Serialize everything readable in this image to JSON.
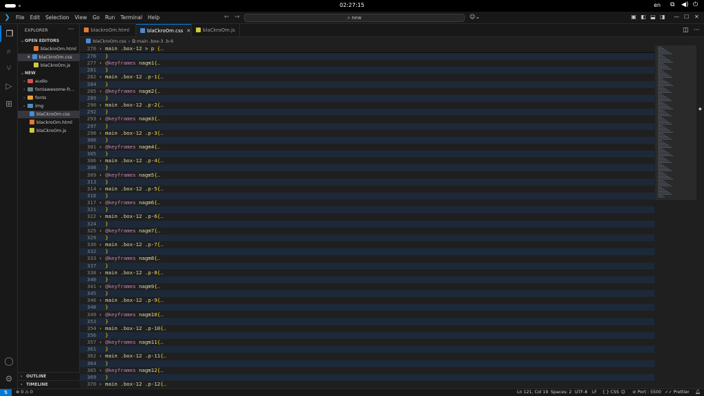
{
  "system": {
    "clock": "02:27:15",
    "language": "en"
  },
  "titlebar": {
    "menu": [
      "File",
      "Edit",
      "Selection",
      "View",
      "Go",
      "Run",
      "Terminal",
      "Help"
    ],
    "search_text": "new"
  },
  "sidebar": {
    "title": "EXPLORER",
    "open_editors_label": "OPEN EDITORS",
    "open_editors": [
      {
        "name": "blackroOm.html",
        "type": "html"
      },
      {
        "name": "blaCkroOm.css",
        "type": "css",
        "selected": true
      },
      {
        "name": "blaCkroOm.js",
        "type": "js"
      }
    ],
    "folder_label": "NEW",
    "folders": [
      {
        "name": "audio",
        "color": "#d9534f"
      },
      {
        "name": "fontawesome-fr...",
        "color": "#6d8086"
      },
      {
        "name": "fonts",
        "color": "#e8a33d"
      },
      {
        "name": "img",
        "color": "#4a90c8"
      }
    ],
    "files": [
      {
        "name": "blaCkroOm.css",
        "type": "css",
        "selected": true
      },
      {
        "name": "blackroOm.html",
        "type": "html"
      },
      {
        "name": "blaCkroOm.js",
        "type": "js"
      }
    ],
    "outline_label": "OUTLINE",
    "timeline_label": "TIMELINE"
  },
  "tabs": [
    {
      "label": "blackroOm.html",
      "type": "html"
    },
    {
      "label": "blaCkroOm.css",
      "type": "css",
      "active": true
    },
    {
      "label": "blaCkroOm.js",
      "type": "js"
    }
  ],
  "breadcrumb": {
    "file": "blaCkroOm.css",
    "symbol": "main .box-3 .b-6"
  },
  "editor": {
    "sticky": {
      "num": "276",
      "kind": "sel",
      "text": "main .box-12 > p {"
    },
    "lines": [
      {
        "num": "276",
        "kind": "close"
      },
      {
        "num": "277",
        "kind": "kf",
        "name": "nagm1"
      },
      {
        "num": "281",
        "kind": "close"
      },
      {
        "num": "282",
        "kind": "sel",
        "text": "main .box-12 .p-1{"
      },
      {
        "num": "284",
        "kind": "close"
      },
      {
        "num": "285",
        "kind": "kf",
        "name": "nagm2"
      },
      {
        "num": "289",
        "kind": "close"
      },
      {
        "num": "290",
        "kind": "sel",
        "text": "main .box-12 .p-2{"
      },
      {
        "num": "292",
        "kind": "close"
      },
      {
        "num": "293",
        "kind": "kf",
        "name": "nagm3"
      },
      {
        "num": "297",
        "kind": "close"
      },
      {
        "num": "298",
        "kind": "sel",
        "text": "main .box-12 .p-3{"
      },
      {
        "num": "300",
        "kind": "close"
      },
      {
        "num": "301",
        "kind": "kf",
        "name": "nagm4"
      },
      {
        "num": "305",
        "kind": "close"
      },
      {
        "num": "306",
        "kind": "sel",
        "text": "main .box-12 .p-4{"
      },
      {
        "num": "308",
        "kind": "close"
      },
      {
        "num": "309",
        "kind": "kf",
        "name": "nagm5"
      },
      {
        "num": "313",
        "kind": "close"
      },
      {
        "num": "314",
        "kind": "sel",
        "text": "main .box-12 .p-5{"
      },
      {
        "num": "316",
        "kind": "close"
      },
      {
        "num": "317",
        "kind": "kf",
        "name": "nagm6"
      },
      {
        "num": "321",
        "kind": "close"
      },
      {
        "num": "322",
        "kind": "sel",
        "text": "main .box-12 .p-6{"
      },
      {
        "num": "324",
        "kind": "close"
      },
      {
        "num": "325",
        "kind": "kf",
        "name": "nagm7"
      },
      {
        "num": "329",
        "kind": "close"
      },
      {
        "num": "330",
        "kind": "sel",
        "text": "main .box-12 .p-7{"
      },
      {
        "num": "332",
        "kind": "close"
      },
      {
        "num": "333",
        "kind": "kf",
        "name": "nagm8"
      },
      {
        "num": "337",
        "kind": "close"
      },
      {
        "num": "338",
        "kind": "sel",
        "text": "main .box-12 .p-8{"
      },
      {
        "num": "340",
        "kind": "close"
      },
      {
        "num": "341",
        "kind": "kf",
        "name": "nagm9"
      },
      {
        "num": "345",
        "kind": "close"
      },
      {
        "num": "346",
        "kind": "sel",
        "text": "main .box-12 .p-9{"
      },
      {
        "num": "348",
        "kind": "close"
      },
      {
        "num": "349",
        "kind": "kf",
        "name": "nagm10"
      },
      {
        "num": "353",
        "kind": "close"
      },
      {
        "num": "354",
        "kind": "sel",
        "text": "main .box-12 .p-10{"
      },
      {
        "num": "356",
        "kind": "close"
      },
      {
        "num": "357",
        "kind": "kf",
        "name": "nagm11"
      },
      {
        "num": "361",
        "kind": "close"
      },
      {
        "num": "362",
        "kind": "sel",
        "text": "main .box-12 .p-11{"
      },
      {
        "num": "364",
        "kind": "close"
      },
      {
        "num": "365",
        "kind": "kf",
        "name": "nagm12"
      },
      {
        "num": "369",
        "kind": "close"
      },
      {
        "num": "370",
        "kind": "sel",
        "text": "main .box-12 .p-12{"
      }
    ]
  },
  "statusbar": {
    "problems": "0 ⚠ 0",
    "position": "Ln 121, Col 19",
    "spaces": "Spaces: 2",
    "encoding": "UTF-8",
    "eol": "LF",
    "language": "{ } CSS",
    "port": "Port : 5500",
    "prettier": "Prettier"
  }
}
